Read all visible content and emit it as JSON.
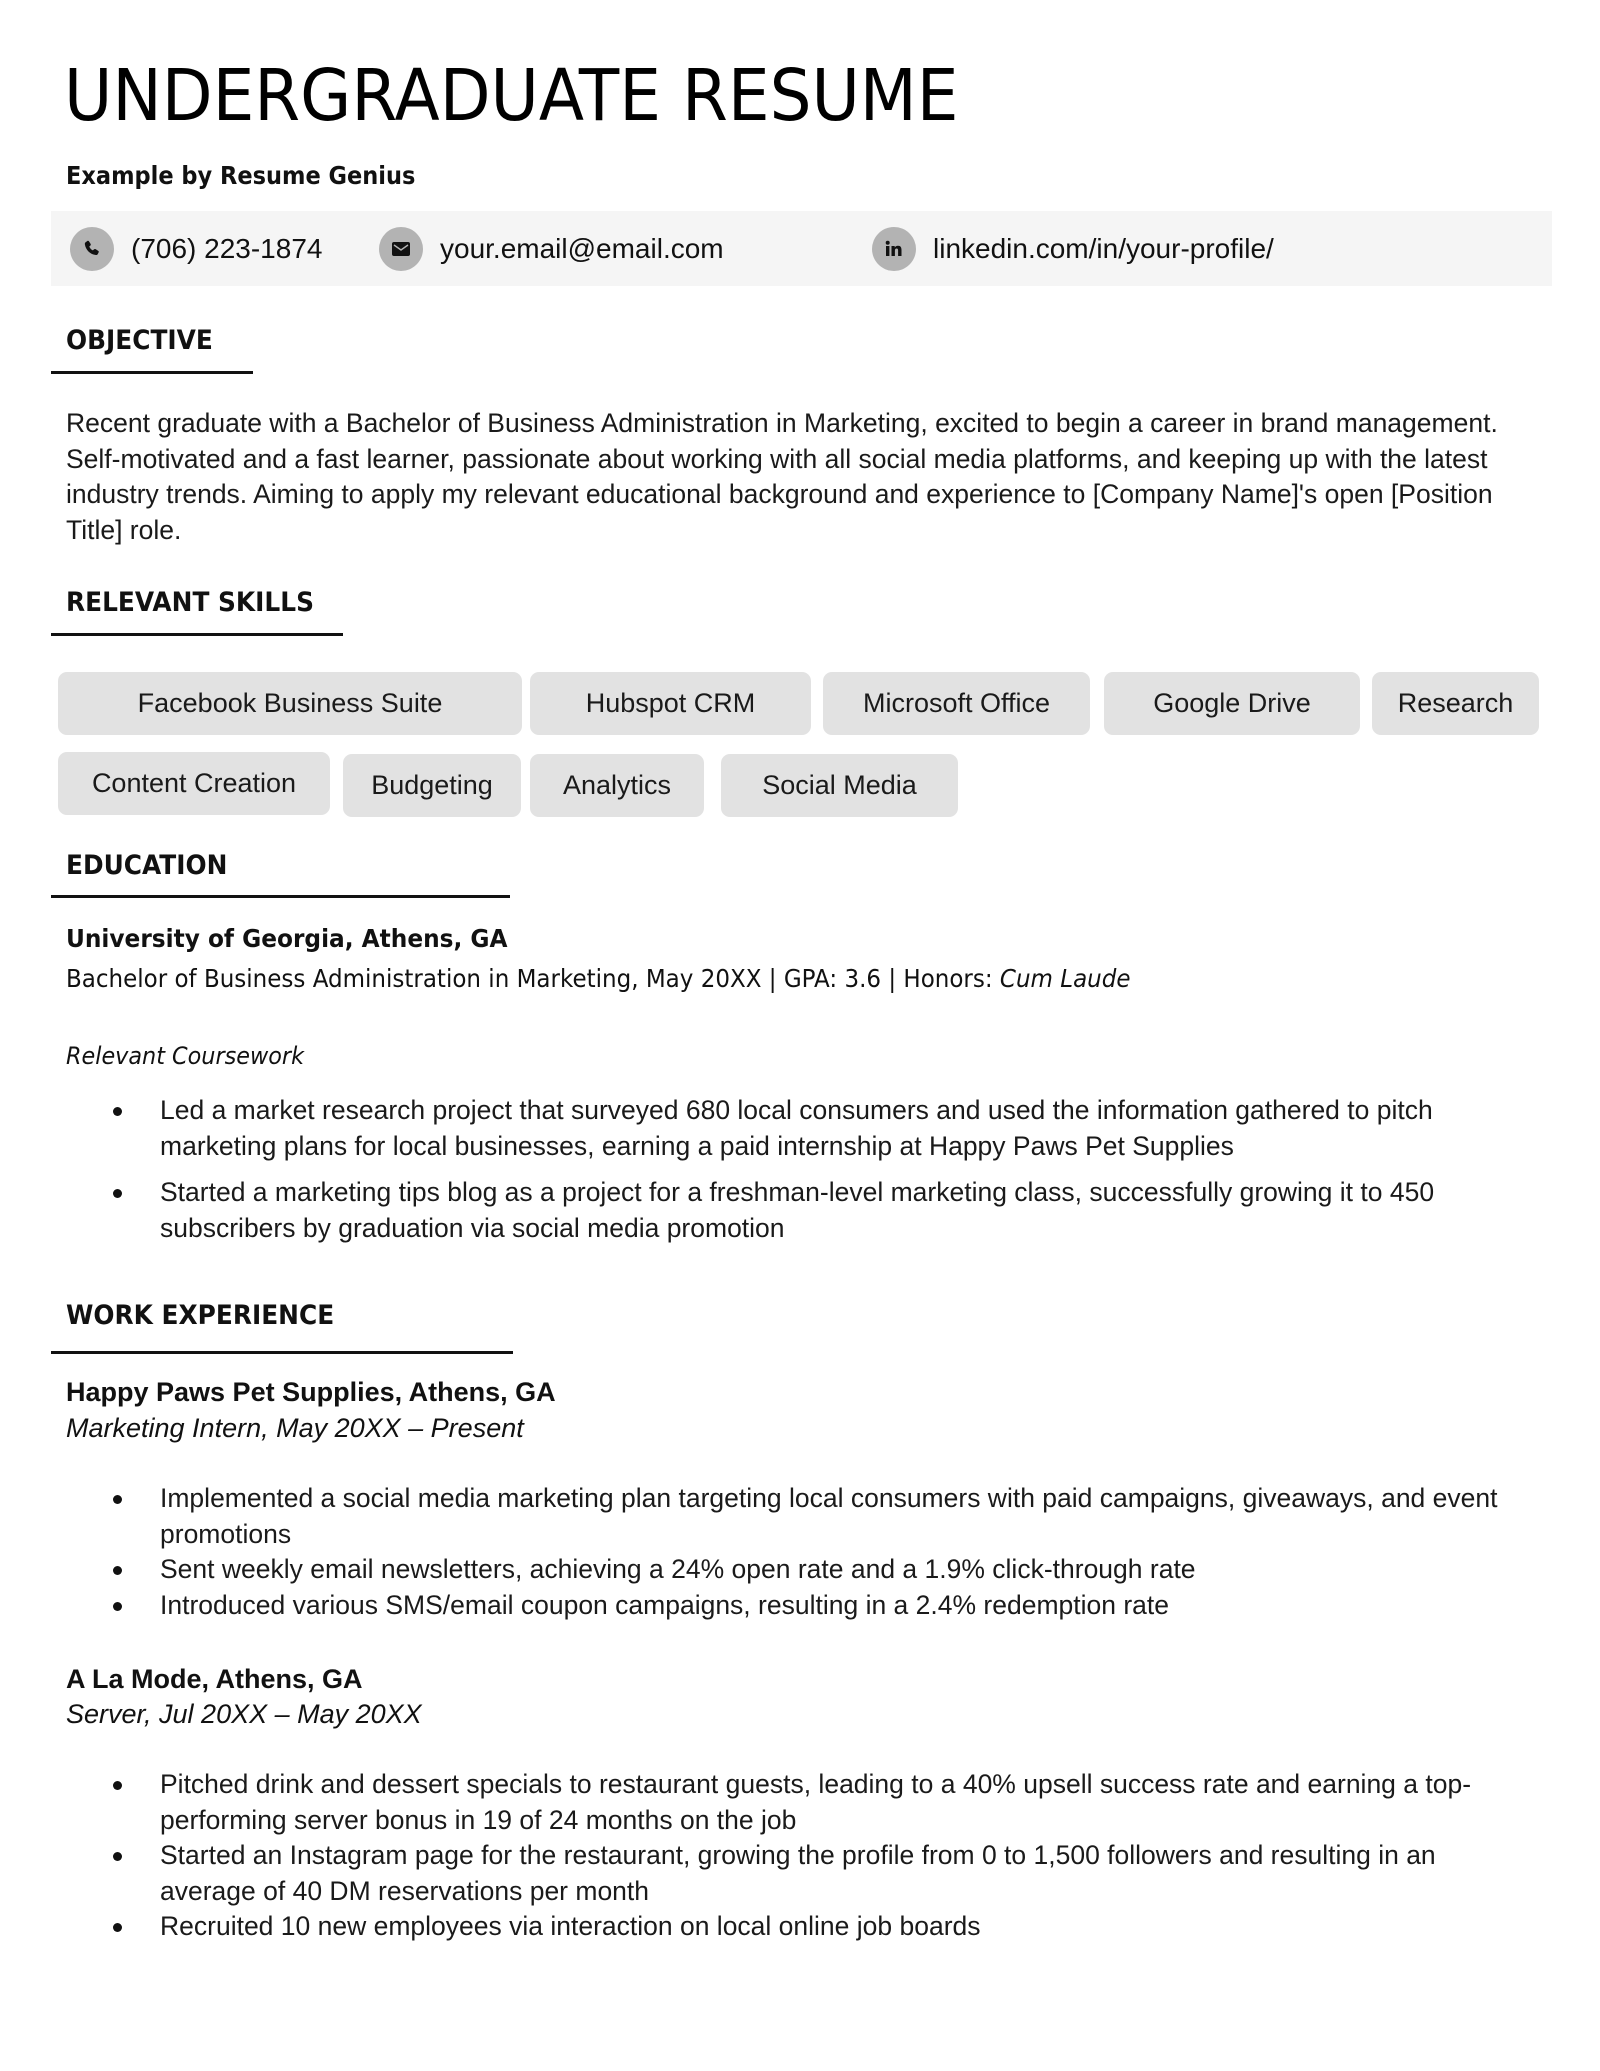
{
  "header": {
    "title": "UNDERGRADUATE RESUME",
    "subtitle": "Example by Resume Genius"
  },
  "contact": {
    "phone": {
      "icon": "phone-icon",
      "text": "(706) 223-1874"
    },
    "email": {
      "icon": "envelope-icon",
      "text": "your.email@email.com"
    },
    "linkedin": {
      "icon": "linkedin-icon",
      "text": "linkedin.com/in/your-profile/"
    },
    "bar_color": "#f5f5f5",
    "icon_bg_color": "#b3b3b3"
  },
  "objective": {
    "heading": "OBJECTIVE",
    "text": "Recent graduate with a Bachelor of Business Administration in Marketing, excited to begin a career in brand management. Self-motivated and a fast learner, passionate about working with all social media platforms, and keeping up with the latest industry trends. Aiming to apply my relevant educational background and experience to [Company Name]'s open [Position Title] role."
  },
  "skills": {
    "heading": "RELEVANT SKILLS",
    "pill_color": "#e2e2e2",
    "items": [
      "Facebook Business Suite",
      "Hubspot CRM",
      "Microsoft Office",
      "Google Drive",
      "Research",
      "Content Creation",
      "Budgeting",
      "Analytics",
      "Social Media"
    ]
  },
  "education": {
    "heading": "EDUCATION",
    "school": "University of Georgia, Athens, GA",
    "degree": "Bachelor of Business Administration in Marketing, May 20XX | GPA: 3.6 | Honors: ",
    "honors": "Cum Laude",
    "coursework_label": "Relevant Coursework",
    "bullets": [
      "Led a market research project that surveyed 680 local consumers and used the information gathered to pitch marketing plans for local businesses, earning a paid internship at Happy Paws Pet Supplies",
      "Started a marketing tips blog as a project for a freshman-level marketing class, successfully growing it to 450 subscribers by graduation via social media promotion"
    ]
  },
  "experience": {
    "heading": "WORK EXPERIENCE",
    "jobs": [
      {
        "employer": "Happy Paws Pet Supplies, Athens, GA",
        "role": "Marketing Intern, May 20XX – Present",
        "bullets": [
          "Implemented a social media marketing plan targeting local consumers with paid campaigns, giveaways, and event promotions",
          "Sent weekly email newsletters, achieving a 24% open rate and a 1.9% click-through rate",
          "Introduced various SMS/email coupon campaigns, resulting in a 2.4% redemption rate"
        ]
      },
      {
        "employer": "A La Mode, Athens, GA",
        "role": "Server, Jul 20XX – May 20XX",
        "bullets": [
          "Pitched drink and dessert specials to restaurant guests, leading to a 40% upsell success rate and earning a top-performing server bonus in 19 of 24 months on the job",
          "Started an Instagram page for the restaurant, growing the profile from 0 to 1,500 followers and resulting in an average of 40 DM reservations per month",
          "Recruited 10 new employees via interaction on local online job boards"
        ]
      }
    ]
  }
}
